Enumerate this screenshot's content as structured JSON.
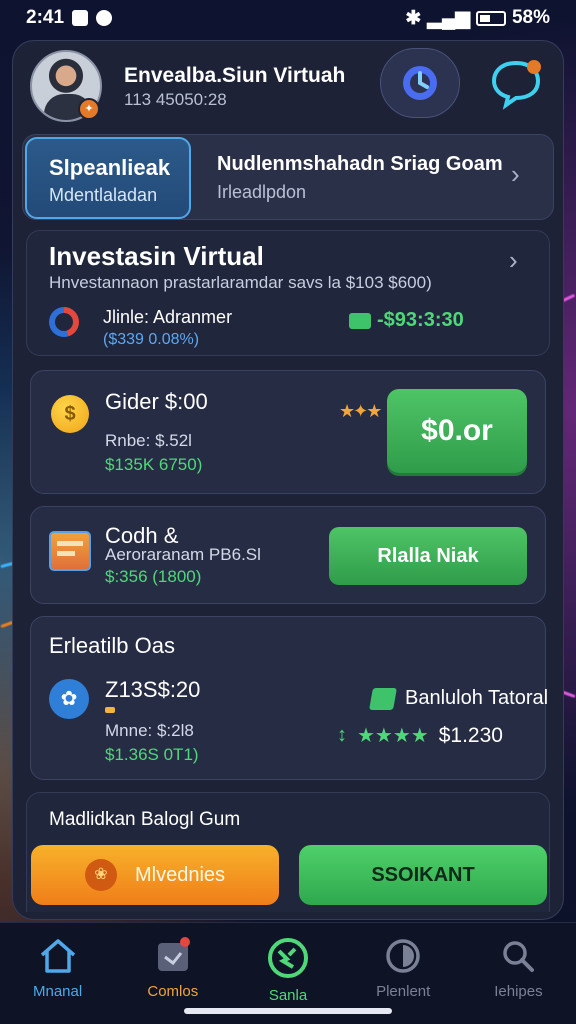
{
  "status_bar": {
    "time": "2:41",
    "battery": "58%"
  },
  "header": {
    "user_name": "Envealba.Siun Virtuah",
    "user_sub": "113 45050:28"
  },
  "tabs": [
    {
      "title": "Slpeanlieak",
      "sub": "Mdentlaladan"
    },
    {
      "title": "Nudlenmshahadn Sriag Goam",
      "sub": "Irleadlpdon"
    }
  ],
  "invest": {
    "title": "Investasin Virtual",
    "desc": "Hnvestannaon prastarlaramdar savs la $103 $600)",
    "asset_name": "Jlinle: Adranmer",
    "asset_sub": "($339 0.08%)",
    "asset_gain": "-$93:3:30"
  },
  "card1": {
    "title": "Gider $:00",
    "sub": "Rnbe: $.52l",
    "green": "$135K 6750)",
    "button": "$0.or",
    "coin": "$"
  },
  "card2": {
    "title": "Codh &",
    "sub": "Aeroraranam PB6.Sl",
    "green": "$:356 (1800)",
    "button": "Rlalla Niak"
  },
  "card3": {
    "title": "Erleatilb Oas",
    "amount": "Z13S$:20",
    "sub": "Mnne: $:2l8",
    "green": "$1.36S 0T1)",
    "total_label": "Banluloh Tatoral",
    "rating_value": "$1.230",
    "stars": "★★★★"
  },
  "bottom": {
    "title": "Madlidkan Balogl Gum",
    "left_button": "Mlvednies",
    "right_button": "SSOIKANT"
  },
  "nav": [
    {
      "label": "Mnanal",
      "color": "#4fa8e8"
    },
    {
      "label": "Comlos",
      "color": "#f0a43a"
    },
    {
      "label": "Sanla",
      "color": "#4fd878"
    },
    {
      "label": "Plenlent",
      "color": "#7a8196"
    },
    {
      "label": "Iehipes",
      "color": "#7a8196"
    }
  ]
}
